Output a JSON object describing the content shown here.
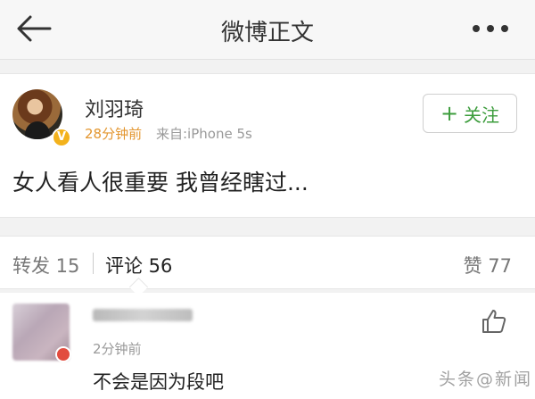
{
  "header": {
    "title": "微博正文"
  },
  "post": {
    "author": "刘羽琦",
    "verified_badge": "V",
    "time": "28分钟前",
    "source": "来自:iPhone 5s",
    "follow_label": "关注",
    "text": "女人看人很重要 我曾经瞎过..."
  },
  "stats": {
    "repost": "转发 15",
    "comment": "评论 56",
    "like": "赞 77"
  },
  "comment": {
    "time": "2分钟前",
    "text": "不会是因为段吧"
  },
  "watermark": "头条@新闻",
  "colors": {
    "follow_green": "#3d9d3d",
    "time_orange": "#e3962f",
    "badge_gold": "#f3b21c"
  },
  "icons": [
    "back-arrow-icon",
    "more-dots-icon",
    "plus-icon",
    "thumbs-up-icon"
  ]
}
